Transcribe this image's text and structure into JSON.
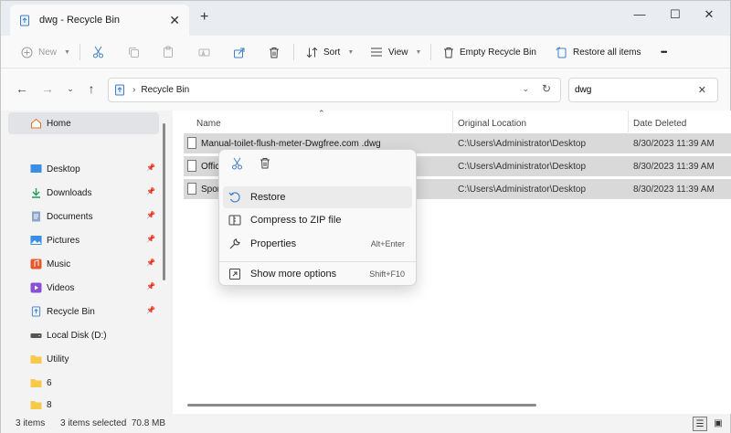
{
  "window": {
    "tab_title": "dwg - Recycle Bin",
    "tab_close": "✕",
    "new_tab": "+",
    "controls": {
      "minimize": "—",
      "maximize": "☐",
      "close": "✕"
    }
  },
  "toolbar": {
    "new_label": "New",
    "sort_label": "Sort",
    "view_label": "View",
    "empty_label": "Empty Recycle Bin",
    "restore_all_label": "Restore all items",
    "more_label": "•••"
  },
  "address": {
    "location": "Recycle Bin",
    "search_value": "dwg"
  },
  "sidebar": {
    "items": [
      {
        "label": "Home",
        "icon": "home-icon",
        "pinned": false,
        "selected": true
      },
      {
        "label": "Desktop",
        "icon": "desktop-icon",
        "pinned": true
      },
      {
        "label": "Downloads",
        "icon": "download-icon",
        "pinned": true
      },
      {
        "label": "Documents",
        "icon": "documents-icon",
        "pinned": true
      },
      {
        "label": "Pictures",
        "icon": "pictures-icon",
        "pinned": true
      },
      {
        "label": "Music",
        "icon": "music-icon",
        "pinned": true
      },
      {
        "label": "Videos",
        "icon": "videos-icon",
        "pinned": true
      },
      {
        "label": "Recycle Bin",
        "icon": "recycle-bin-icon",
        "pinned": true
      },
      {
        "label": "Local Disk (D:)",
        "icon": "drive-icon",
        "pinned": false
      },
      {
        "label": "Utility",
        "icon": "folder-icon",
        "pinned": false
      },
      {
        "label": "6",
        "icon": "folder-icon",
        "pinned": false
      },
      {
        "label": "8",
        "icon": "folder-icon",
        "pinned": false
      }
    ]
  },
  "columns": {
    "name": "Name",
    "original_location": "Original Location",
    "date_deleted": "Date Deleted"
  },
  "files": [
    {
      "name": "Manual-toilet-flush-meter-Dwgfree.com .dwg",
      "location": "C:\\Users\\Administrator\\Desktop",
      "date": "8/30/2023 11:39 AM"
    },
    {
      "name": "Offic",
      "location": "C:\\Users\\Administrator\\Desktop",
      "date": "8/30/2023 11:39 AM"
    },
    {
      "name": "Spor",
      "location": "C:\\Users\\Administrator\\Desktop",
      "date": "8/30/2023 11:39 AM"
    }
  ],
  "context_menu": {
    "items": [
      {
        "label": "Restore",
        "shortcut": ""
      },
      {
        "label": "Compress to ZIP file",
        "shortcut": ""
      },
      {
        "label": "Properties",
        "shortcut": "Alt+Enter"
      },
      {
        "label": "Show more options",
        "shortcut": "Shift+F10"
      }
    ]
  },
  "status": {
    "count": "3 items",
    "selection": "3 items selected  70.8 MB"
  },
  "colors": {
    "accent": "#0067c0",
    "folder": "#f7c948",
    "selection": "#d9d9d9"
  }
}
